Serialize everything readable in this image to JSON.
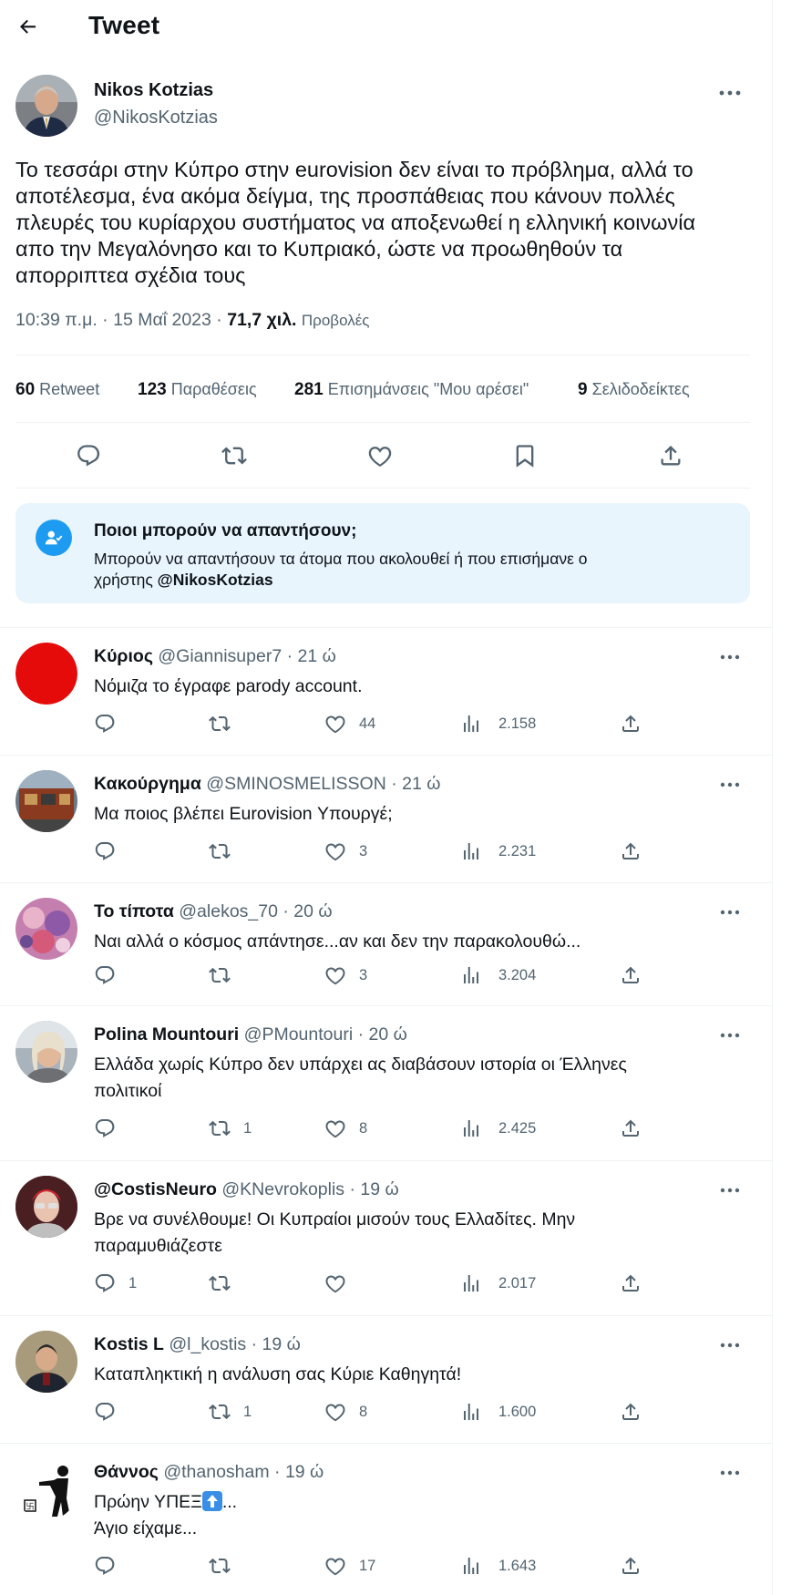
{
  "header": {
    "title": "Tweet"
  },
  "main_tweet": {
    "name": "Nikos Kotzias",
    "handle": "@NikosKotzias",
    "text": "Το τεσσάρι στην Κύπρο στην eurovision δεν είναι το πρόβλημα, αλλά το\nαποτέλεσμα, ένα ακόμα δείγμα, της προσπάθειας που κάνουν πολλές\nπλευρές του κυρίαρχου συστήματος να αποξενωθεί η ελληνική κοινωνία\nαπο την Μεγαλόνησο και το Κυπριακό, ώστε να προωθηθούν τα\nαπορριπτεα σχέδια τους",
    "time": "10:39 π.μ.",
    "date": "15 Μαΐ 2023",
    "views": "71,7 χιλ.",
    "views_label": "Προβολές",
    "stats": {
      "retweets": {
        "count": "60",
        "label": "Retweet"
      },
      "quotes": {
        "count": "123",
        "label": "Παραθέσεις"
      },
      "likes": {
        "count": "281",
        "label": "Επισημάνσεις \"Μου αρέσει\""
      },
      "bookmarks": {
        "count": "9",
        "label": "Σελιδοδείκτες"
      }
    }
  },
  "who_can_reply": {
    "title": "Ποιοι μπορούν να απαντήσουν;",
    "text": "Μπορούν να απαντήσουν τα άτομα που ακολουθεί ή που επισήμανε ο\nχρήστης ",
    "handle": "@NikosKotzias"
  },
  "replies": [
    {
      "name": "Κύριος",
      "handle": "@Giannisuper7",
      "dot": "·",
      "time": "21 ώ",
      "text": "Νόμιζα το έγραφε parody account.",
      "replies": "",
      "retweets": "",
      "likes": "44",
      "views": "2.158"
    },
    {
      "name": "Κακούργημα",
      "handle": "@SMINOSMELISSON",
      "dot": "·",
      "time": "21 ώ",
      "text": "Μα ποιος βλέπει Eurovision Υπουργέ;",
      "replies": "",
      "retweets": "",
      "likes": "3",
      "views": "2.231"
    },
    {
      "name": "Το τίποτα",
      "handle": "@alekos_70",
      "dot": "·",
      "time": "20 ώ",
      "text": "Ναι αλλά ο κόσμος απάντησε...αν και δεν την παρακολουθώ...",
      "replies": "",
      "retweets": "",
      "likes": "3",
      "views": "3.204"
    },
    {
      "name": "Polina Mountouri",
      "handle": "@PMountouri",
      "dot": "·",
      "time": "20 ώ",
      "text": "Ελλάδα χωρίς Κύπρο δεν υπάρχει ας διαβάσουν ιστορία οι Έλληνες\nπολιτικοί",
      "replies": "",
      "retweets": "1",
      "likes": "8",
      "views": "2.425"
    },
    {
      "name": "@CostisNeuro",
      "handle": "@KNevrokoplis",
      "dot": "·",
      "time": "19 ώ",
      "text": "Βρε να συνέλθουμε! Οι Κυπραίοι μισούν τους Ελλαδίτες. Μην\nπαραμυθιάζεστε",
      "replies": "1",
      "retweets": "",
      "likes": "",
      "views": "2.017"
    },
    {
      "name": "Kostis L",
      "handle": "@l_kostis",
      "dot": "·",
      "time": "19 ώ",
      "text": "Καταπληκτική η ανάλυση σας Κύριε Καθηγητά!",
      "replies": "",
      "retweets": "1",
      "likes": "8",
      "views": "1.600"
    },
    {
      "name": "Θάννος",
      "handle": "@thanosham",
      "dot": "·",
      "time": "19 ώ",
      "text_line1": "Πρώην ΥΠΕΞ",
      "text_line1_suffix": "...",
      "text_line2": "Άγιο είχαμε...",
      "replies": "",
      "retweets": "",
      "likes": "17",
      "views": "1.643"
    }
  ],
  "colors": {
    "accent": "#1d9bf0",
    "secondary_text": "#536471",
    "reply_box_bg": "#e8f5fd"
  }
}
